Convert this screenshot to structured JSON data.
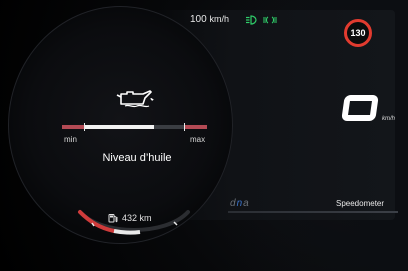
{
  "top": {
    "speed_limit_info": "100",
    "speed_limit_unit": "km/h",
    "headlight_icon": "headlight-icon",
    "drl_icon": "daytime-running-lights-icon",
    "speed_limit_sign": "130"
  },
  "speedometer": {
    "value": "0",
    "unit": "km/h",
    "tab_label": "Speedometer"
  },
  "dna": {
    "prefix": "d",
    "mid": "n",
    "suffix": "a"
  },
  "oil_panel": {
    "title": "Niveau d’huile",
    "min_label": "min",
    "max_label": "max",
    "level_percent": 70
  },
  "range": {
    "value": "432 km"
  },
  "colors": {
    "accent_red": "#e23b2f",
    "dna_blue": "#3c73c8",
    "green_icon": "#2fcf6a"
  }
}
